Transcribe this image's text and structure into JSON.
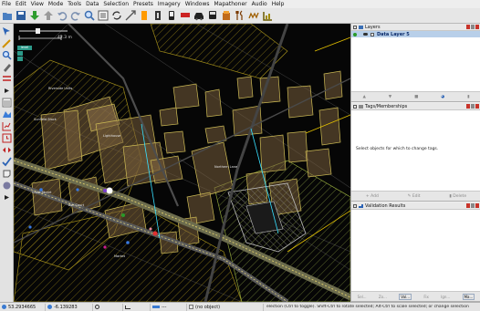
{
  "menu": [
    "File",
    "Edit",
    "View",
    "Mode",
    "Tools",
    "Data",
    "Selection",
    "Presets",
    "Imagery",
    "Windows",
    "Mapathoner",
    "Audio",
    "Help"
  ],
  "toolbar_icons": [
    "open-file-icon",
    "save-icon",
    "download-icon",
    "upload-icon",
    "undo-icon",
    "redo-icon",
    "search-icon",
    "preferences-icon",
    "refresh-icon",
    "zoom-icon",
    "building-icon",
    "door-icon",
    "phone-icon",
    "flag-icon",
    "car-icon",
    "bus-icon",
    "shop-icon",
    "food-icon",
    "leisure-icon",
    "landuse-icon"
  ],
  "map": {
    "scale_label": "42.3 m",
    "layer_badge": "level",
    "labels": [
      "Riverside Units",
      "Lighthouse",
      "Sunfield Block",
      "Northern Lane",
      "Cross Street",
      "Ash Court",
      "Market"
    ]
  },
  "layers_panel": {
    "title": "Layers",
    "layer_name": "Data Layer 5"
  },
  "tags_panel": {
    "title": "Tags/Memberships",
    "empty_message": "Select objects for which to change tags.",
    "add_label": "Add",
    "edit_label": "Edit",
    "delete_label": "Delete"
  },
  "validation_panel": {
    "title": "Validation Results",
    "buttons": [
      "Sel...",
      "Zo...",
      "Val...",
      "Fix",
      "Ign...",
      "Ma..."
    ]
  },
  "status": {
    "lat": "53.2934665",
    "lon": "-6.139283",
    "object": "(no object)",
    "help": "election (Ctrl to toggle). Shift-Ctrl to rotate selected; Alt-Ctrl to scale selected; or change selection"
  },
  "colors": {
    "map_background": "#060606",
    "highlight": "#e4c100",
    "selected_row": "#b8cfe9",
    "cyan_road": "#38e0ff"
  }
}
